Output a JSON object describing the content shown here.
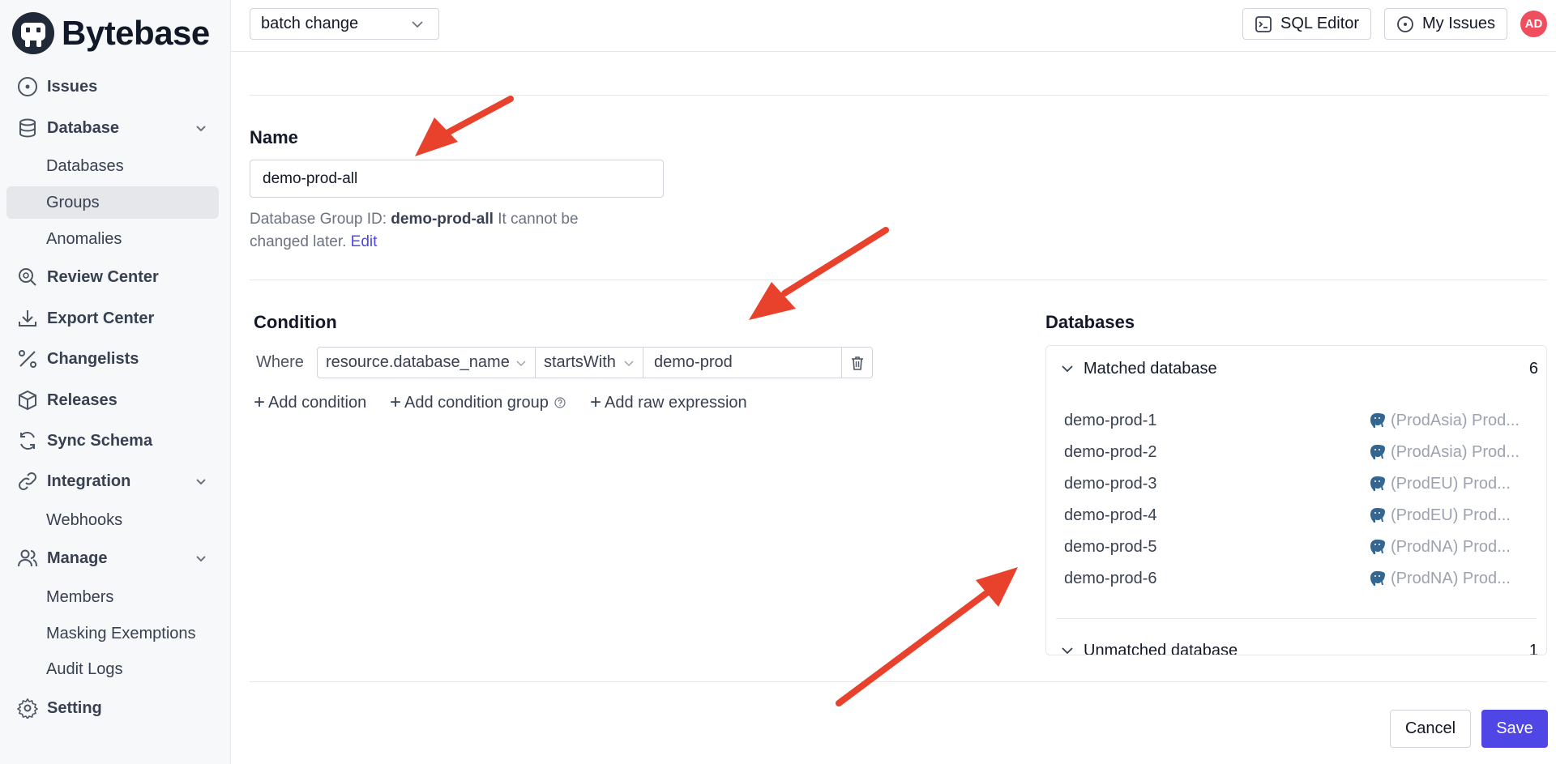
{
  "brand": {
    "name": "Bytebase"
  },
  "sidebar": {
    "items": [
      {
        "label": "Issues",
        "icon": "circle-dot-icon"
      },
      {
        "label": "Database",
        "icon": "database-icon"
      },
      {
        "label": "Databases"
      },
      {
        "label": "Groups"
      },
      {
        "label": "Anomalies"
      },
      {
        "label": "Review Center",
        "icon": "search-review-icon"
      },
      {
        "label": "Export Center",
        "icon": "download-icon"
      },
      {
        "label": "Changelists",
        "icon": "changelist-icon"
      },
      {
        "label": "Releases",
        "icon": "package-icon"
      },
      {
        "label": "Sync Schema",
        "icon": "sync-icon"
      },
      {
        "label": "Integration",
        "icon": "link-icon"
      },
      {
        "label": "Webhooks"
      },
      {
        "label": "Manage",
        "icon": "users-icon"
      },
      {
        "label": "Members"
      },
      {
        "label": "Masking Exemptions"
      },
      {
        "label": "Audit Logs"
      },
      {
        "label": "Setting",
        "icon": "gear-icon"
      }
    ]
  },
  "header": {
    "environment": "batch change",
    "sql_editor": "SQL Editor",
    "my_issues": "My Issues",
    "avatar": "AD"
  },
  "form": {
    "name_label": "Name",
    "name_value": "demo-prod-all",
    "help_prefix": "Database Group ID:",
    "help_id": "demo-prod-all",
    "help_suffix": "It cannot be changed later.",
    "help_edit": "Edit",
    "condition_label": "Condition",
    "where": "Where",
    "condition": {
      "field": "resource.database_name",
      "operator": "startsWith",
      "value": "demo-prod"
    },
    "add_condition": "Add condition",
    "add_condition_group": "Add condition group",
    "add_raw_expression": "Add raw expression"
  },
  "databases": {
    "label": "Databases",
    "matched_label": "Matched database",
    "matched_count": "6",
    "matched": [
      {
        "name": "demo-prod-1",
        "instance": "(ProdAsia) Prod..."
      },
      {
        "name": "demo-prod-2",
        "instance": "(ProdAsia) Prod..."
      },
      {
        "name": "demo-prod-3",
        "instance": "(ProdEU) Prod..."
      },
      {
        "name": "demo-prod-4",
        "instance": "(ProdEU) Prod..."
      },
      {
        "name": "demo-prod-5",
        "instance": "(ProdNA) Prod..."
      },
      {
        "name": "demo-prod-6",
        "instance": "(ProdNA) Prod..."
      }
    ],
    "unmatched_label": "Unmatched database",
    "unmatched_count": "1"
  },
  "footer": {
    "cancel": "Cancel",
    "save": "Save"
  },
  "colors": {
    "accent": "#4f46e5",
    "annotation_arrow": "#e8412c",
    "avatar": "#ef4e5e"
  }
}
